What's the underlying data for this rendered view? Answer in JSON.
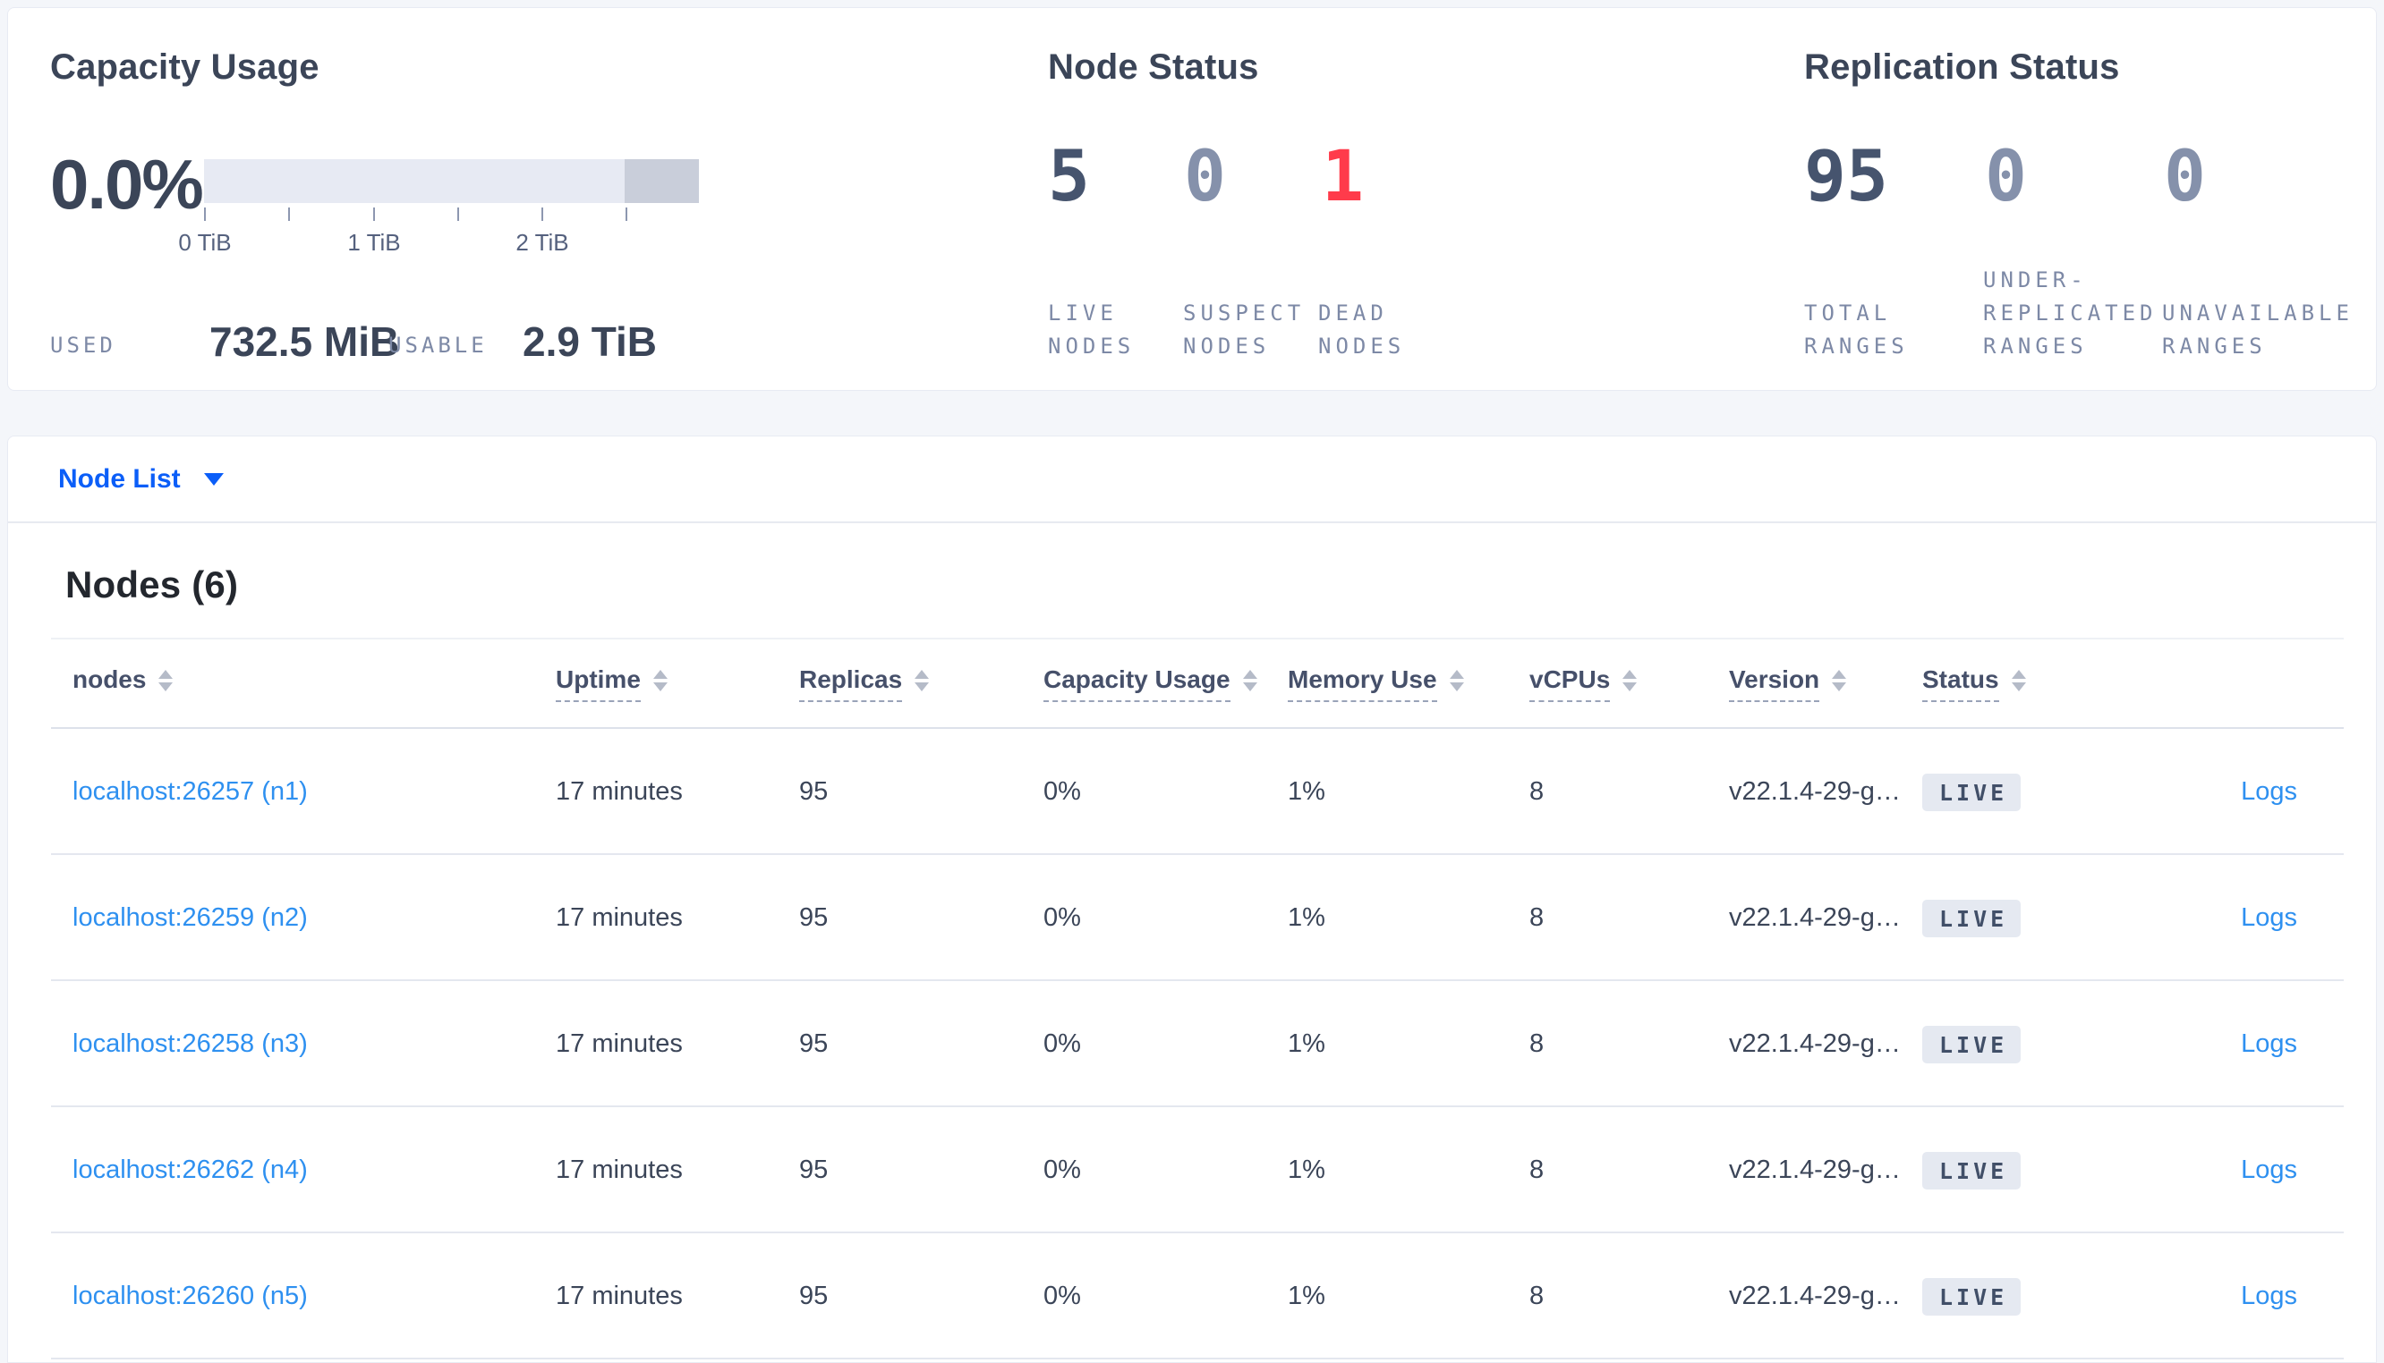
{
  "theme": {
    "page_bg": "#f4f6fa",
    "card_bg": "#ffffff",
    "dark_text": "#3b4558",
    "muted_label": "#7d89a6",
    "stat_dark": "#46546e",
    "stat_muted": "#8591ab",
    "stat_red": "#ff3b4b",
    "row_link_blue": "#2e90f0",
    "action_blue": "#0b5ef8",
    "badge_bg": "#e5e9f1",
    "capacity_bar_fill": "#e7eaf3",
    "capacity_bar_extra": "#c9ceda",
    "separator": "#e4e7ef"
  },
  "capacity": {
    "title": "Capacity Usage",
    "percent": "0.0%",
    "tick_labels": [
      "0 TiB",
      "1 TiB",
      "2 TiB"
    ],
    "used_label": "USED",
    "used_value": "732.5 MiB",
    "usable_label": "USABLE",
    "usable_value": "2.9 TiB"
  },
  "node_status": {
    "title": "Node Status",
    "stats": [
      {
        "value": "5",
        "label": "LIVE\nNODES",
        "color": "#46546e"
      },
      {
        "value": "0",
        "label": "SUSPECT\nNODES",
        "color": "#8591ab"
      },
      {
        "value": "1",
        "label": "DEAD\nNODES",
        "color": "#ff3b4b"
      }
    ]
  },
  "replication_status": {
    "title": "Replication Status",
    "stats": [
      {
        "value": "95",
        "label": "TOTAL\nRANGES",
        "color": "#46546e"
      },
      {
        "value": "0",
        "label": "UNDER-\nREPLICATED\nRANGES",
        "color": "#8591ab"
      },
      {
        "value": "0",
        "label": "UNAVAILABLE\nRANGES",
        "color": "#8591ab"
      }
    ]
  },
  "node_list_bar": {
    "label": "Node List"
  },
  "nodes_table": {
    "title": "Nodes (6)",
    "columns": [
      "nodes",
      "Uptime",
      "Replicas",
      "Capacity Usage",
      "Memory Use",
      "vCPUs",
      "Version",
      "Status"
    ],
    "rows": [
      {
        "node": "localhost:26257 (n1)",
        "uptime": "17 minutes",
        "replicas": "95",
        "capacity": "0%",
        "memory": "1%",
        "vcpus": "8",
        "version": "v22.1.4-29-g…",
        "status": "LIVE",
        "logs": "Logs"
      },
      {
        "node": "localhost:26259 (n2)",
        "uptime": "17 minutes",
        "replicas": "95",
        "capacity": "0%",
        "memory": "1%",
        "vcpus": "8",
        "version": "v22.1.4-29-g…",
        "status": "LIVE",
        "logs": "Logs"
      },
      {
        "node": "localhost:26258 (n3)",
        "uptime": "17 minutes",
        "replicas": "95",
        "capacity": "0%",
        "memory": "1%",
        "vcpus": "8",
        "version": "v22.1.4-29-g…",
        "status": "LIVE",
        "logs": "Logs"
      },
      {
        "node": "localhost:26262 (n4)",
        "uptime": "17 minutes",
        "replicas": "95",
        "capacity": "0%",
        "memory": "1%",
        "vcpus": "8",
        "version": "v22.1.4-29-g…",
        "status": "LIVE",
        "logs": "Logs"
      },
      {
        "node": "localhost:26260 (n5)",
        "uptime": "17 minutes",
        "replicas": "95",
        "capacity": "0%",
        "memory": "1%",
        "vcpus": "8",
        "version": "v22.1.4-29-g…",
        "status": "LIVE",
        "logs": "Logs"
      }
    ]
  }
}
